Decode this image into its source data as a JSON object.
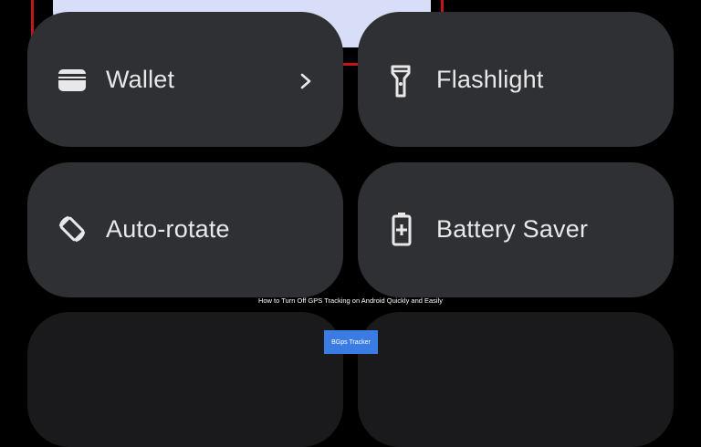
{
  "colors": {
    "background": "#000000",
    "tile": "#2f3033",
    "tile_text": "#e8e8ea",
    "top_tile": "#d8def7",
    "highlight": "#c0161c",
    "badge": "#3b7be4"
  },
  "tiles": [
    {
      "label": "Wallet",
      "icon": "wallet-icon",
      "has_chevron": true
    },
    {
      "label": "Flashlight",
      "icon": "flashlight-icon"
    },
    {
      "label": "Auto-rotate",
      "icon": "auto-rotate-icon"
    },
    {
      "label": "Battery Saver",
      "icon": "battery-saver-icon"
    }
  ],
  "overlay": {
    "caption": "How to Turn Off GPS Tracking on Android Quickly and Easily",
    "badge": "BGps Tracker"
  }
}
